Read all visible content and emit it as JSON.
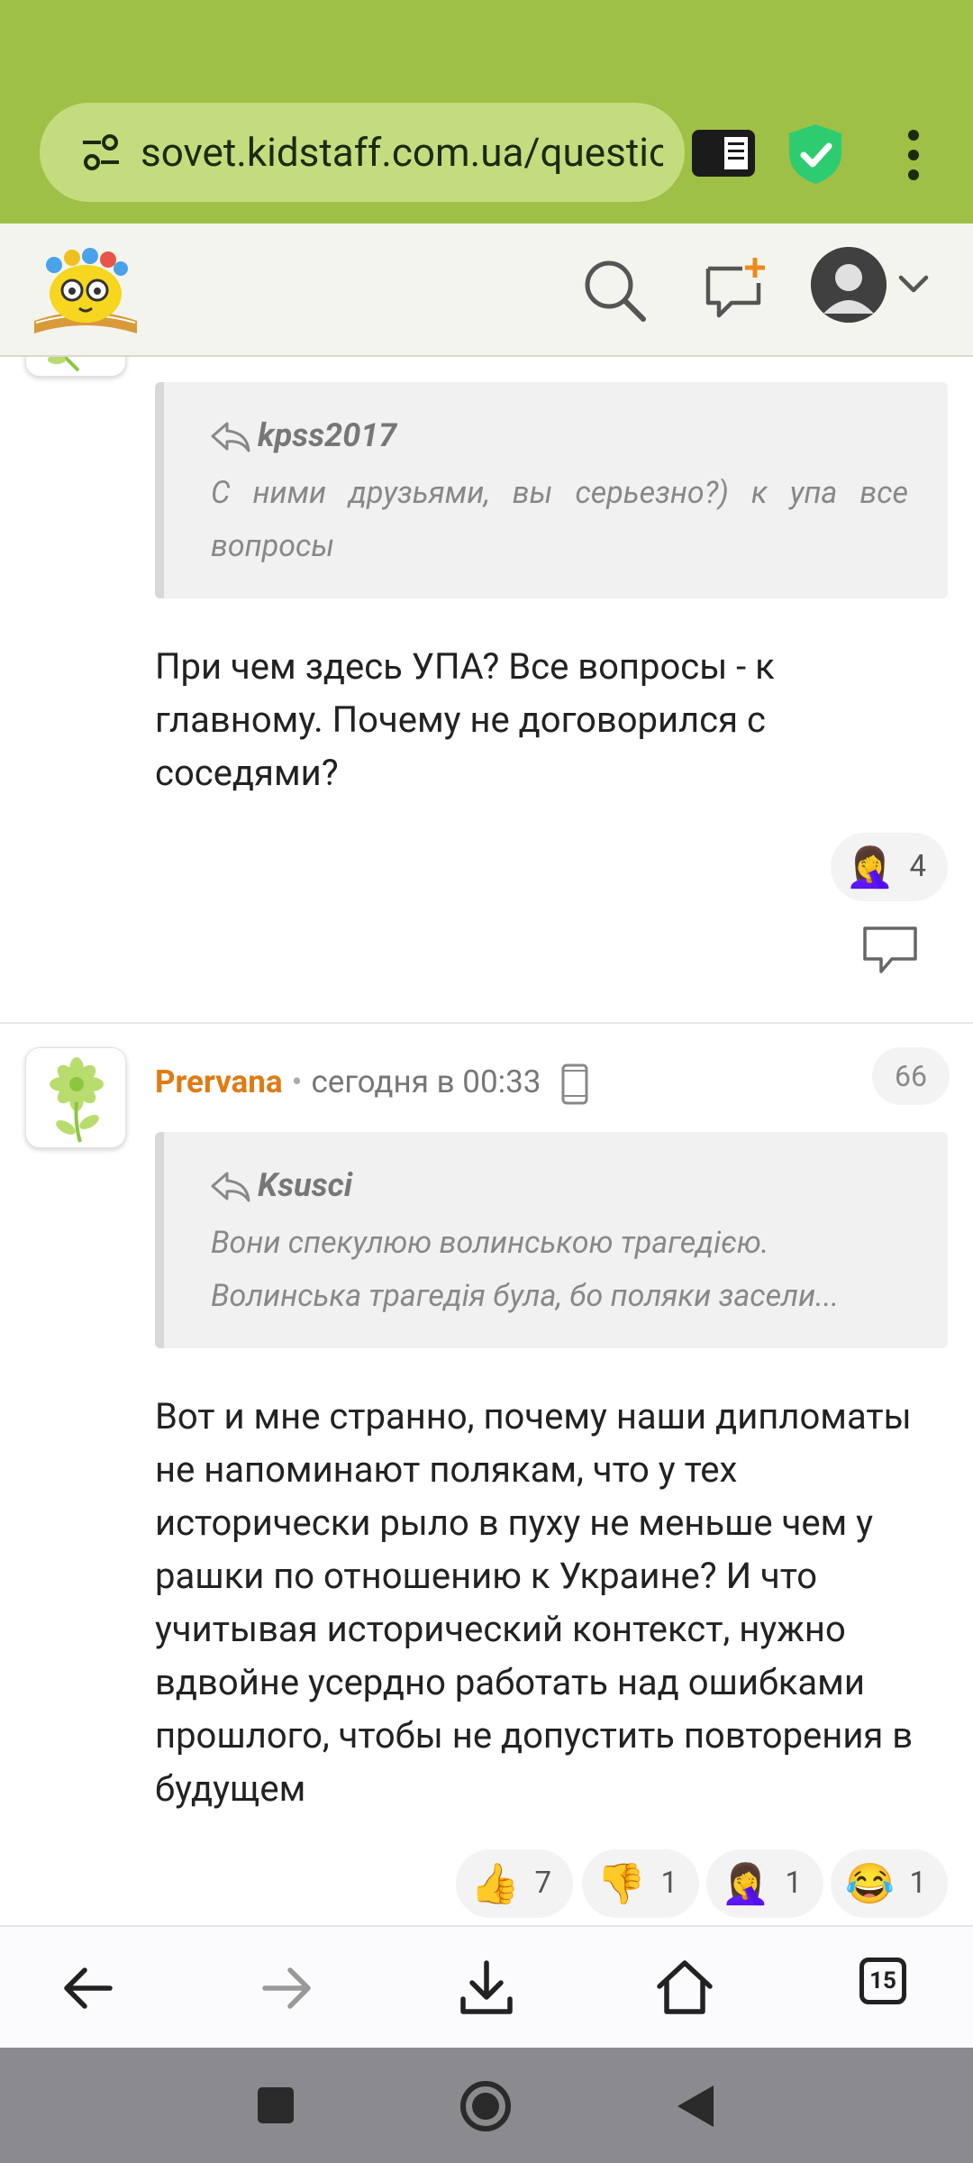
{
  "browser": {
    "url": "sovet.kidstaff.com.ua/questio",
    "tabs_count": "15"
  },
  "posts": [
    {
      "quote_author": "kpss2017",
      "quote_text": "С ними друзьями, вы серьезно?) к упа все вопросы",
      "body": "При чем здесь УПА? Все вопросы - к главному. Почему не договорился с соседями?",
      "reactions": [
        {
          "emoji": "🤦‍♀️",
          "count": "4"
        }
      ]
    },
    {
      "author": "Prervana",
      "time": "сегодня в 00:33",
      "number": "66",
      "quote_author": "Ksusci",
      "quote_line1": "Вони спекулюю волинською трагедією.",
      "quote_line2": "Волинська трагедія була, бо поляки засели...",
      "body": "Вот и мне странно, почему наши дипломаты не напоминают полякам, что у тех исторически рыло в пуху не меньше чем у рашки по отношению к Украине? И что учитывая исторический контекст, нужно вдвойне усердно работать над ошибками прошлого, чтобы не допустить повторения в будущем",
      "reactions": [
        {
          "emoji": "👍",
          "count": "7"
        },
        {
          "emoji": "👎",
          "count": "1"
        },
        {
          "emoji": "🤦‍♀️",
          "count": "1"
        },
        {
          "emoji": "😂",
          "count": "1"
        }
      ]
    }
  ],
  "colors": {
    "browser_bar": "#9ec046",
    "author_name": "#e07b14",
    "shield": "#2ecc71"
  }
}
